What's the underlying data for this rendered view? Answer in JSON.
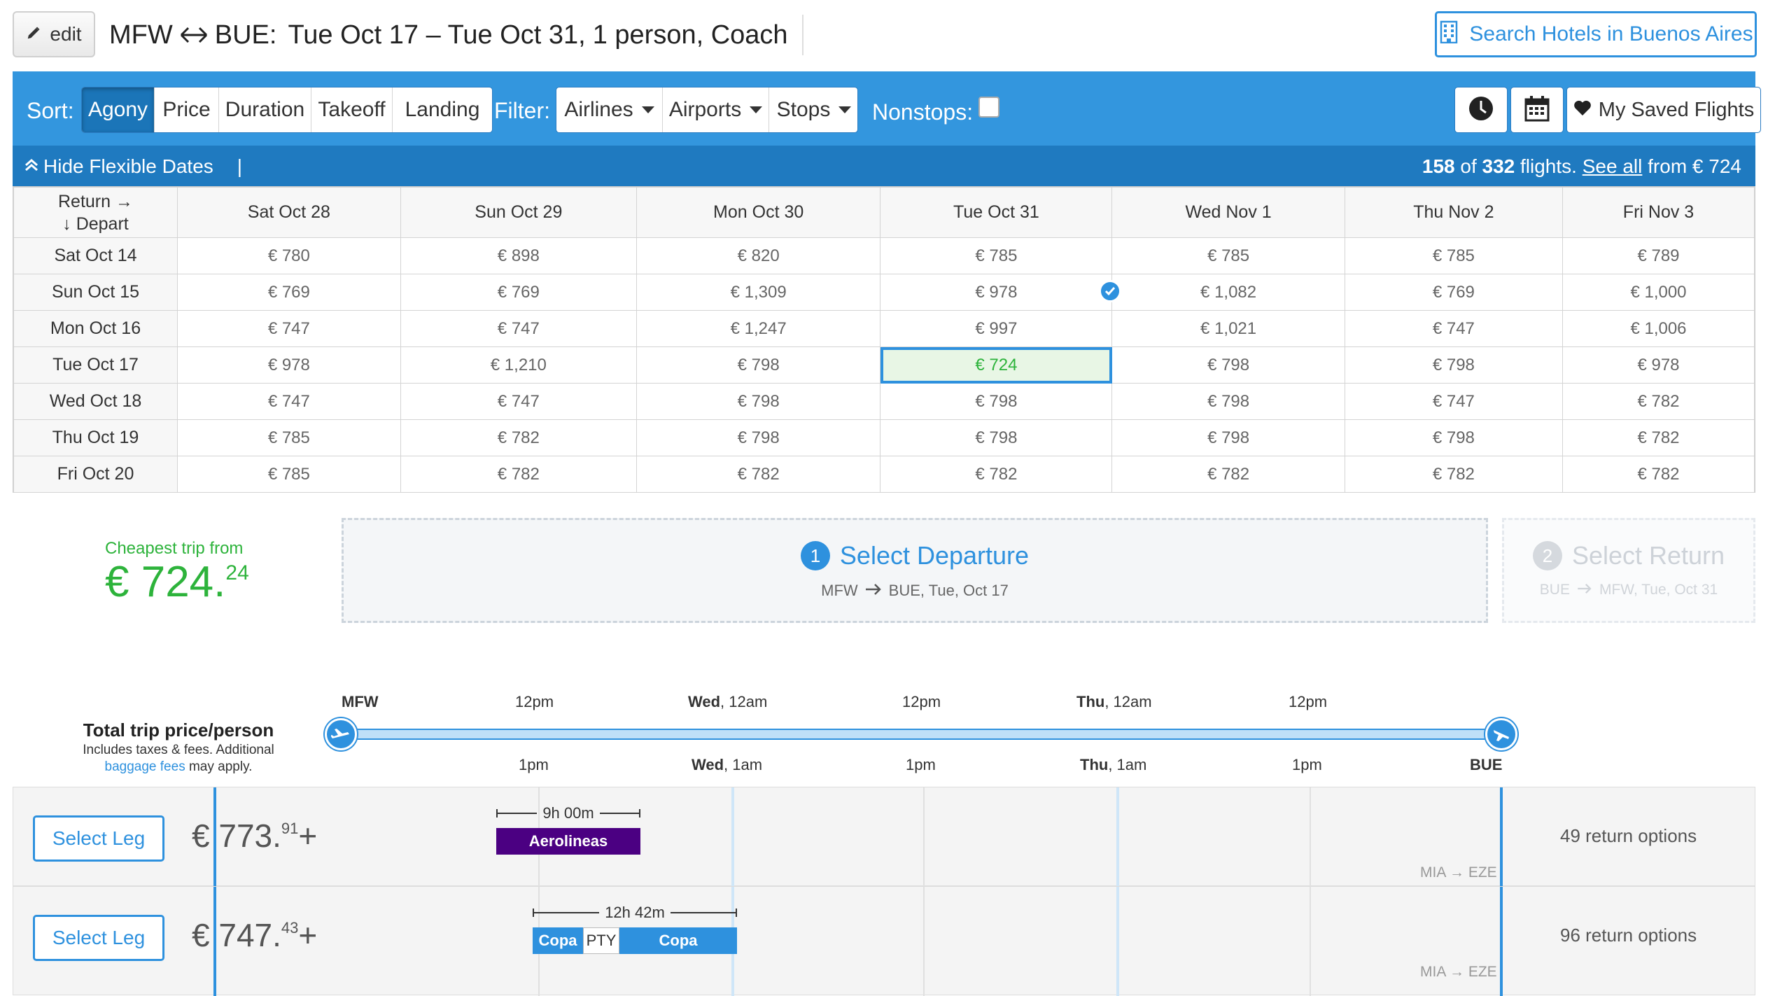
{
  "header": {
    "edit_label": "edit",
    "origin": "MFW",
    "destination": "BUE:",
    "dates": "Tue Oct 17 – Tue Oct 31,",
    "passengers": "1 person, Coach",
    "hotels_label": "Search Hotels in Buenos Aires"
  },
  "toolbar": {
    "sort_label": "Sort:",
    "sort_options": [
      "Agony",
      "Price",
      "Duration",
      "Takeoff",
      "Landing"
    ],
    "active_sort": "Agony",
    "filter_label": "Filter:",
    "filter_options": [
      "Airlines",
      "Airports",
      "Stops"
    ],
    "nonstops_label": "Nonstops:",
    "saved_label": "My Saved Flights"
  },
  "flexbar": {
    "hide_label": "Hide Flexible Dates",
    "count_shown": "158",
    "of": "of",
    "count_total": "332",
    "flights_text": "flights.",
    "see_all": "See all",
    "from_text": "from € 724"
  },
  "matrix": {
    "corner_return": "Return →",
    "corner_depart": "↓ Depart",
    "return_dates": [
      "Sat Oct 28",
      "Sun Oct 29",
      "Mon Oct 30",
      "Tue Oct 31",
      "Wed Nov 1",
      "Thu Nov 2",
      "Fri Nov 3"
    ],
    "rows": [
      {
        "depart": "Sat Oct 14",
        "prices": [
          "€ 780",
          "€ 898",
          "€ 820",
          "€ 785",
          "€ 785",
          "€ 785",
          "€ 789"
        ]
      },
      {
        "depart": "Sun Oct 15",
        "prices": [
          "€ 769",
          "€ 769",
          "€ 1,309",
          "€ 978",
          "€ 1,082",
          "€ 769",
          "€ 1,000"
        ]
      },
      {
        "depart": "Mon Oct 16",
        "prices": [
          "€ 747",
          "€ 747",
          "€ 1,247",
          "€ 997",
          "€ 1,021",
          "€ 747",
          "€ 1,006"
        ]
      },
      {
        "depart": "Tue Oct 17",
        "prices": [
          "€ 978",
          "€ 1,210",
          "€ 798",
          "€ 724",
          "€ 798",
          "€ 798",
          "€ 978"
        ]
      },
      {
        "depart": "Wed Oct 18",
        "prices": [
          "€ 747",
          "€ 747",
          "€ 798",
          "€ 798",
          "€ 798",
          "€ 747",
          "€ 782"
        ]
      },
      {
        "depart": "Thu Oct 19",
        "prices": [
          "€ 785",
          "€ 782",
          "€ 798",
          "€ 798",
          "€ 798",
          "€ 798",
          "€ 782"
        ]
      },
      {
        "depart": "Fri Oct 20",
        "prices": [
          "€ 785",
          "€ 782",
          "€ 782",
          "€ 782",
          "€ 782",
          "€ 782",
          "€ 782"
        ]
      }
    ]
  },
  "cheapest": {
    "label": "Cheapest trip from",
    "price_main": "€ 724.",
    "price_cents": "24"
  },
  "steps": {
    "departure": {
      "num": "1",
      "title": "Select Departure",
      "from": "MFW",
      "to": "BUE, Tue, Oct 17"
    },
    "return": {
      "num": "2",
      "title": "Select Return",
      "from": "BUE",
      "to": "MFW, Tue, Oct 31"
    }
  },
  "timeline": {
    "total_label": "Total trip price/person",
    "total_sub1": "Includes taxes & fees. Additional",
    "baggage_link": "baggage fees",
    "total_sub2": "may apply.",
    "origin": "MFW",
    "destination": "BUE",
    "top_ticks": [
      {
        "bold": "",
        "text": "12pm"
      },
      {
        "bold": "Wed",
        "text": ", 12am"
      },
      {
        "bold": "",
        "text": "12pm"
      },
      {
        "bold": "Thu",
        "text": ", 12am"
      },
      {
        "bold": "",
        "text": "12pm"
      }
    ],
    "bottom_ticks": [
      {
        "bold": "",
        "text": "1pm"
      },
      {
        "bold": "Wed",
        "text": ", 1am"
      },
      {
        "bold": "",
        "text": "1pm"
      },
      {
        "bold": "Thu",
        "text": ", 1am"
      },
      {
        "bold": "",
        "text": "1pm"
      }
    ]
  },
  "results": [
    {
      "select_label": "Select Leg",
      "price_main": "€ 773.",
      "price_cents": "91",
      "price_plus": "+",
      "duration": "9h 00m",
      "segments": [
        {
          "label": "Aerolineas",
          "color": "#4b0082"
        }
      ],
      "return_options": "49 return options",
      "via": "MIA → EZE"
    },
    {
      "select_label": "Select Leg",
      "price_main": "€ 747.",
      "price_cents": "43",
      "price_plus": "+",
      "duration": "12h 42m",
      "segments": [
        {
          "label": "Copa",
          "color": "#2e91de"
        },
        {
          "label": "PTY",
          "color": "#ffffff"
        },
        {
          "label": "Copa",
          "color": "#2e91de"
        }
      ],
      "return_options": "96 return options",
      "via": "MIA → EZE"
    }
  ],
  "colors": {
    "accent": "#2e91de",
    "toolbar": "#3396de",
    "flexbar": "#1f7ac0",
    "cheapest": "#2db33b",
    "aerolineas": "#4b0082"
  }
}
